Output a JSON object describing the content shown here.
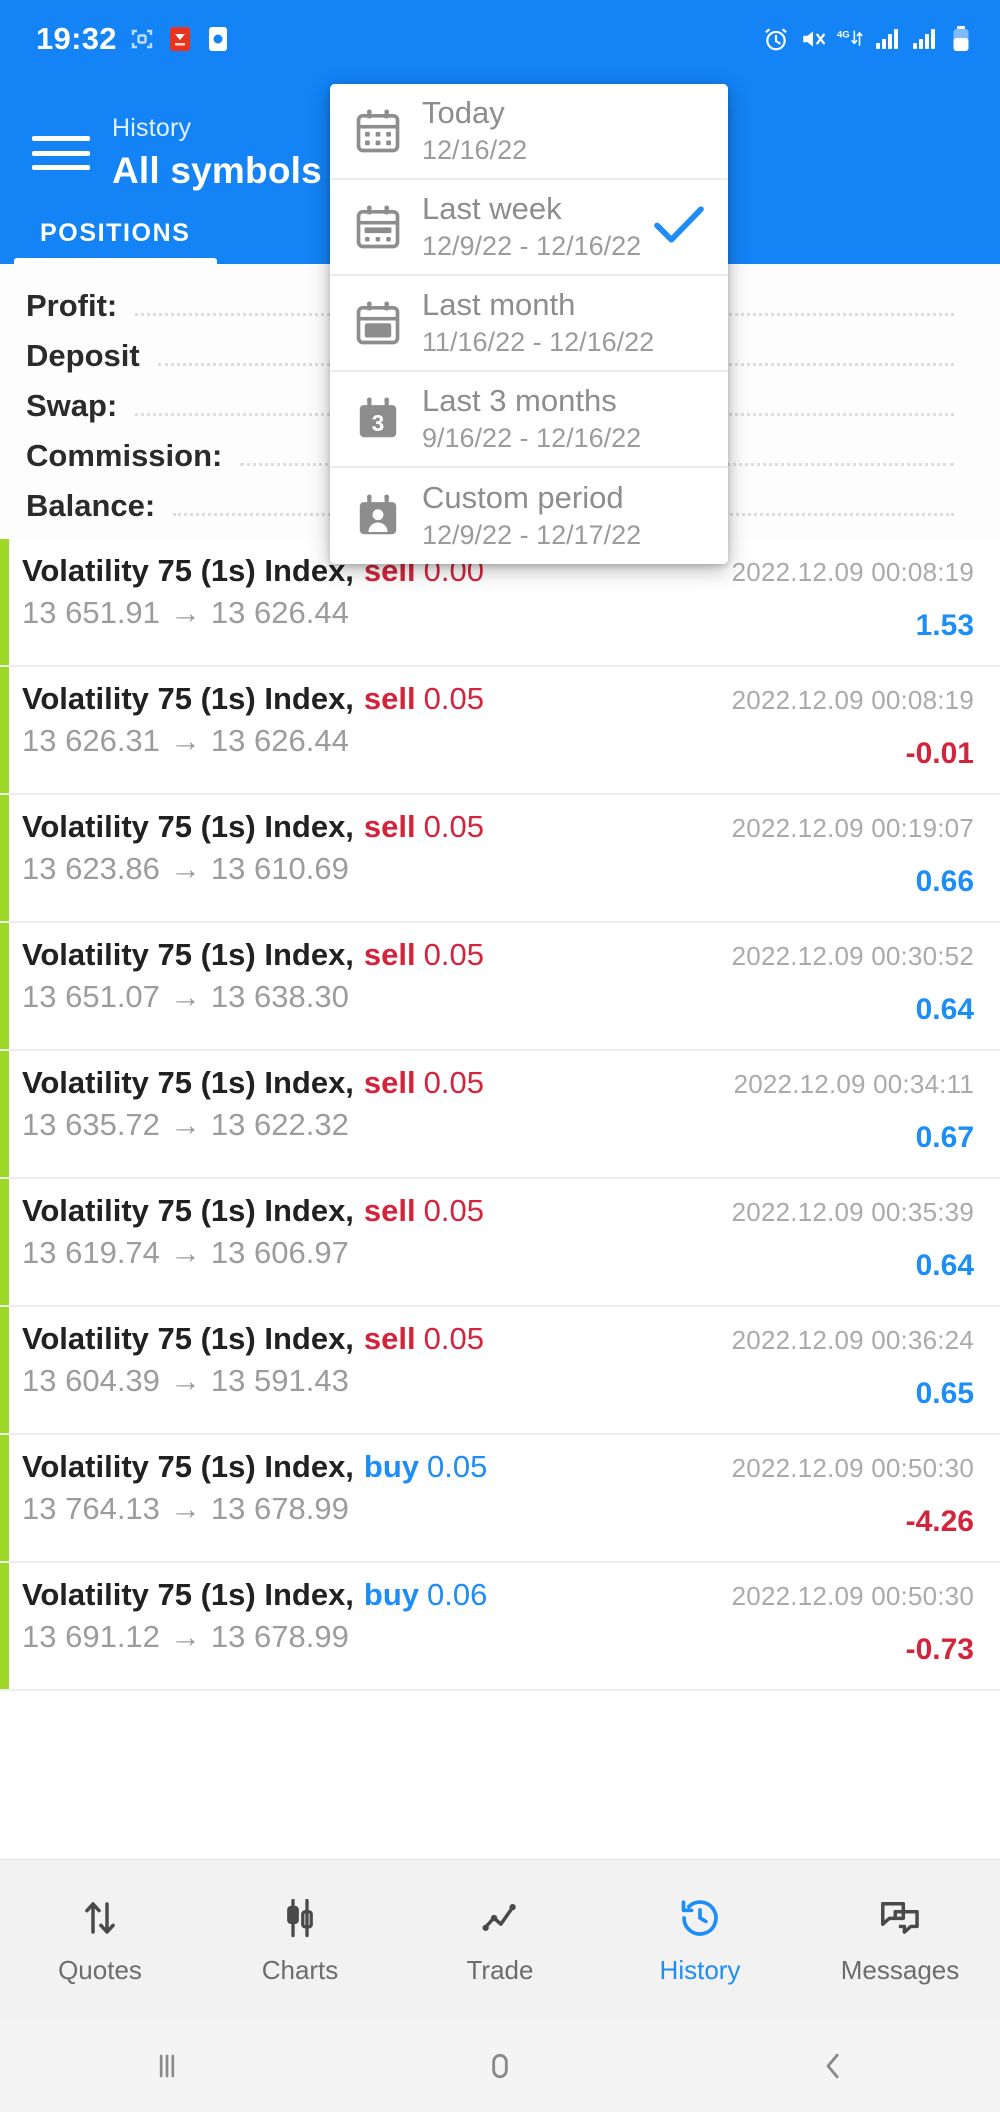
{
  "statusbar": {
    "clock": "19:32",
    "left_icons": [
      "screenshot-icon",
      "app-badge-red-icon",
      "app-badge-icon"
    ],
    "right_icons": [
      "alarm-icon",
      "mute-icon",
      "4g-data-icon",
      "signal-1-icon",
      "signal-2-icon",
      "battery-icon"
    ],
    "network_label": "4G"
  },
  "appbar": {
    "menu_icon": "hamburger-menu-icon",
    "subtitle": "History",
    "title": "All symbols",
    "tabs": [
      {
        "label": "POSITIONS",
        "active": true
      }
    ]
  },
  "summary": {
    "rows": [
      {
        "label": "Profit:",
        "value": ""
      },
      {
        "label": "Deposit",
        "value": ""
      },
      {
        "label": "Swap:",
        "value": ""
      },
      {
        "label": "Commission:",
        "value": ""
      },
      {
        "label": "Balance:",
        "value": ""
      }
    ]
  },
  "period_menu": {
    "items": [
      {
        "icon": "calendar-today-icon",
        "title": "Today",
        "subtitle": "12/16/22",
        "selected": false
      },
      {
        "icon": "calendar-week-icon",
        "title": "Last week",
        "subtitle": "12/9/22 - 12/16/22",
        "selected": true
      },
      {
        "icon": "calendar-month-icon",
        "title": "Last month",
        "subtitle": "11/16/22 - 12/16/22",
        "selected": false
      },
      {
        "icon": "calendar-3months-icon",
        "title": "Last 3 months",
        "subtitle": "9/16/22 - 12/16/22",
        "selected": false
      },
      {
        "icon": "calendar-custom-icon",
        "title": "Custom period",
        "subtitle": "12/9/22 - 12/17/22",
        "selected": false
      }
    ],
    "check_icon": "checkmark-icon"
  },
  "trades": [
    {
      "symbol": "Volatility 75 (1s) Index,",
      "side": "sell",
      "volume": "0.00",
      "open": "13 651.91",
      "close": "13 626.44",
      "time": "2022.12.09 00:08:19",
      "profit": "1.53",
      "profit_sign": "pos"
    },
    {
      "symbol": "Volatility 75 (1s) Index,",
      "side": "sell",
      "volume": "0.05",
      "open": "13 626.31",
      "close": "13 626.44",
      "time": "2022.12.09 00:08:19",
      "profit": "-0.01",
      "profit_sign": "neg"
    },
    {
      "symbol": "Volatility 75 (1s) Index,",
      "side": "sell",
      "volume": "0.05",
      "open": "13 623.86",
      "close": "13 610.69",
      "time": "2022.12.09 00:19:07",
      "profit": "0.66",
      "profit_sign": "pos"
    },
    {
      "symbol": "Volatility 75 (1s) Index,",
      "side": "sell",
      "volume": "0.05",
      "open": "13 651.07",
      "close": "13 638.30",
      "time": "2022.12.09 00:30:52",
      "profit": "0.64",
      "profit_sign": "pos"
    },
    {
      "symbol": "Volatility 75 (1s) Index,",
      "side": "sell",
      "volume": "0.05",
      "open": "13 635.72",
      "close": "13 622.32",
      "time": "2022.12.09 00:34:11",
      "profit": "0.67",
      "profit_sign": "pos"
    },
    {
      "symbol": "Volatility 75 (1s) Index,",
      "side": "sell",
      "volume": "0.05",
      "open": "13 619.74",
      "close": "13 606.97",
      "time": "2022.12.09 00:35:39",
      "profit": "0.64",
      "profit_sign": "pos"
    },
    {
      "symbol": "Volatility 75 (1s) Index,",
      "side": "sell",
      "volume": "0.05",
      "open": "13 604.39",
      "close": "13 591.43",
      "time": "2022.12.09 00:36:24",
      "profit": "0.65",
      "profit_sign": "pos"
    },
    {
      "symbol": "Volatility 75 (1s) Index,",
      "side": "buy",
      "volume": "0.05",
      "open": "13 764.13",
      "close": "13 678.99",
      "time": "2022.12.09 00:50:30",
      "profit": "-4.26",
      "profit_sign": "neg"
    },
    {
      "symbol": "Volatility 75 (1s) Index,",
      "side": "buy",
      "volume": "0.06",
      "open": "13 691.12",
      "close": "13 678.99",
      "time": "2022.12.09 00:50:30",
      "profit": "-0.73",
      "profit_sign": "neg"
    }
  ],
  "arrow_glyph": "→",
  "bottom_nav": [
    {
      "label": "Quotes",
      "icon": "updown-arrows-icon",
      "active": false
    },
    {
      "label": "Charts",
      "icon": "candlestick-icon",
      "active": false
    },
    {
      "label": "Trade",
      "icon": "line-chart-icon",
      "active": false
    },
    {
      "label": "History",
      "icon": "clock-history-icon",
      "active": true
    },
    {
      "label": "Messages",
      "icon": "chat-bubbles-icon",
      "active": false
    }
  ],
  "system_nav": [
    {
      "icon": "recents-icon"
    },
    {
      "icon": "home-icon"
    },
    {
      "icon": "back-icon"
    }
  ],
  "colors": {
    "brand_blue": "#1383f5",
    "accent_green": "#9fd928",
    "sell_red": "#d2253c",
    "buy_blue": "#1e8df5"
  }
}
